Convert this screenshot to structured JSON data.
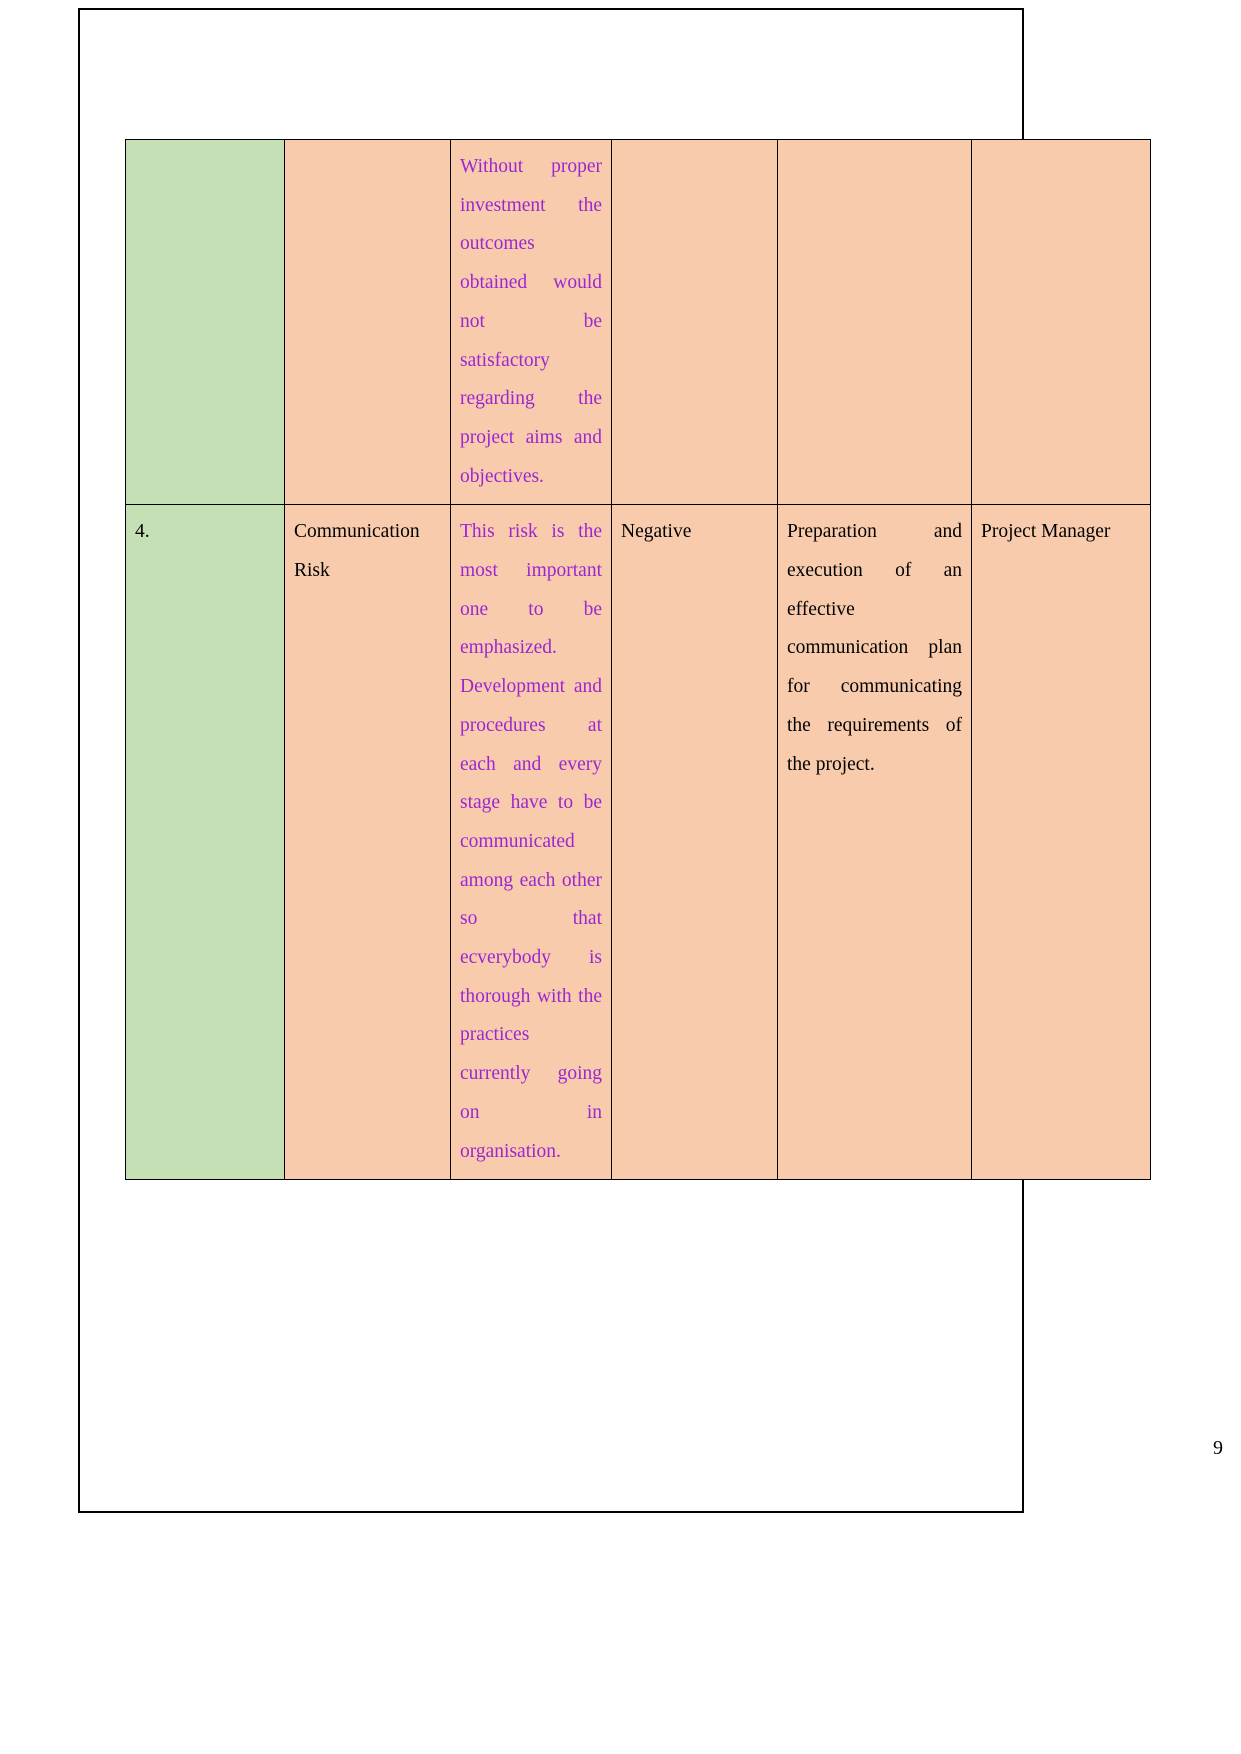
{
  "document": {
    "page_number": "9",
    "colors": {
      "serial_column_bg": "#c5e0b4",
      "data_column_bg": "#f8cbad",
      "description_text": "#9c27d0",
      "body_text": "#000000",
      "border": "#000000"
    }
  },
  "table": {
    "name": "risk-register-table",
    "rows": [
      {
        "serial": "",
        "risk": "",
        "description": "Without proper investment the outcomes obtained would not be satisfactory regarding the project aims and objectives.",
        "impact": "",
        "mitigation": "",
        "owner": ""
      },
      {
        "serial": "4.",
        "risk": "Communication Risk",
        "description": "This risk is the most important one to be emphasized. Development and procedures at each and every stage have to be communicated among each other so that ecverybody is thorough with the practices currently going on in organisation.",
        "impact": "Negative",
        "mitigation": "Preparation and execution of an effective communication plan for communicating the requirements of the project.",
        "owner": "Project Manager"
      }
    ]
  }
}
